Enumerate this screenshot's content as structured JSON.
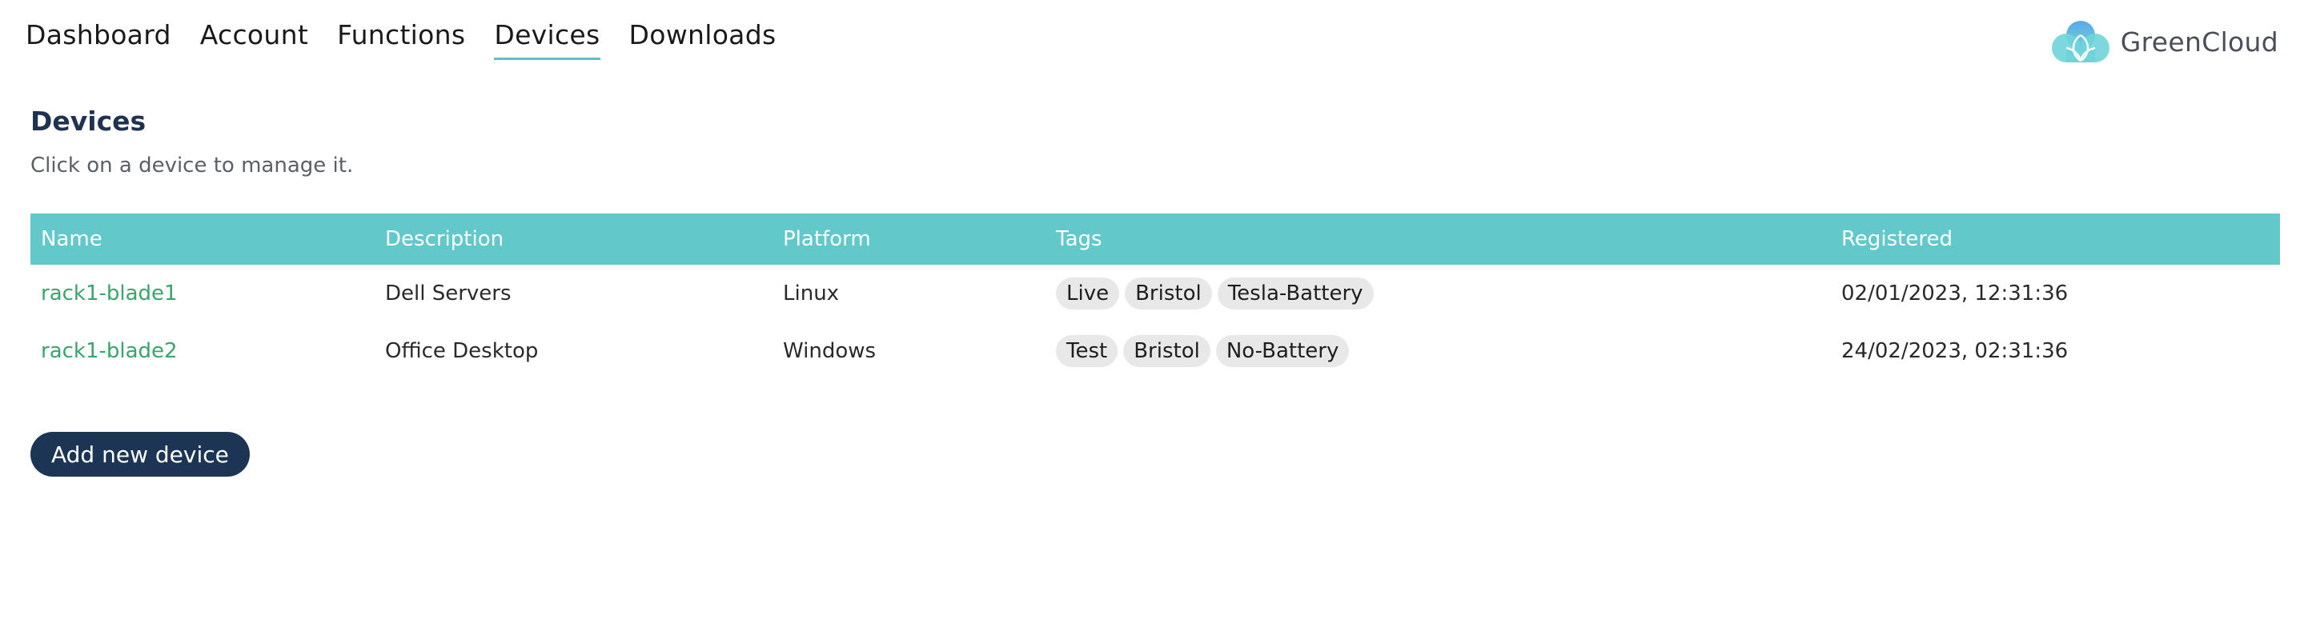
{
  "nav": {
    "tabs": [
      {
        "label": "Dashboard",
        "active": false
      },
      {
        "label": "Account",
        "active": false
      },
      {
        "label": "Functions",
        "active": false
      },
      {
        "label": "Devices",
        "active": true
      },
      {
        "label": "Downloads",
        "active": false
      }
    ]
  },
  "brand": {
    "name": "GreenCloud",
    "logo_icon": "cloud-logo-icon",
    "colors": {
      "top": "#5aa8e8",
      "bottom": "#6fd4da"
    }
  },
  "page": {
    "title": "Devices",
    "subtitle": "Click on a device to manage it."
  },
  "table": {
    "headers": [
      "Name",
      "Description",
      "Platform",
      "Tags",
      "Registered"
    ],
    "rows": [
      {
        "name": "rack1-blade1",
        "description": "Dell Servers",
        "platform": "Linux",
        "tags": [
          "Live",
          "Bristol",
          "Tesla-Battery"
        ],
        "registered": "02/01/2023, 12:31:36"
      },
      {
        "name": "rack1-blade2",
        "description": "Office Desktop",
        "platform": "Windows",
        "tags": [
          "Test",
          "Bristol",
          "No-Battery"
        ],
        "registered": "24/02/2023, 02:31:36"
      }
    ]
  },
  "actions": {
    "add_device_label": "Add new device"
  },
  "colors": {
    "accent": "#63c8c9",
    "link": "#3aa56b",
    "button": "#1c3555",
    "title": "#1f3350"
  }
}
